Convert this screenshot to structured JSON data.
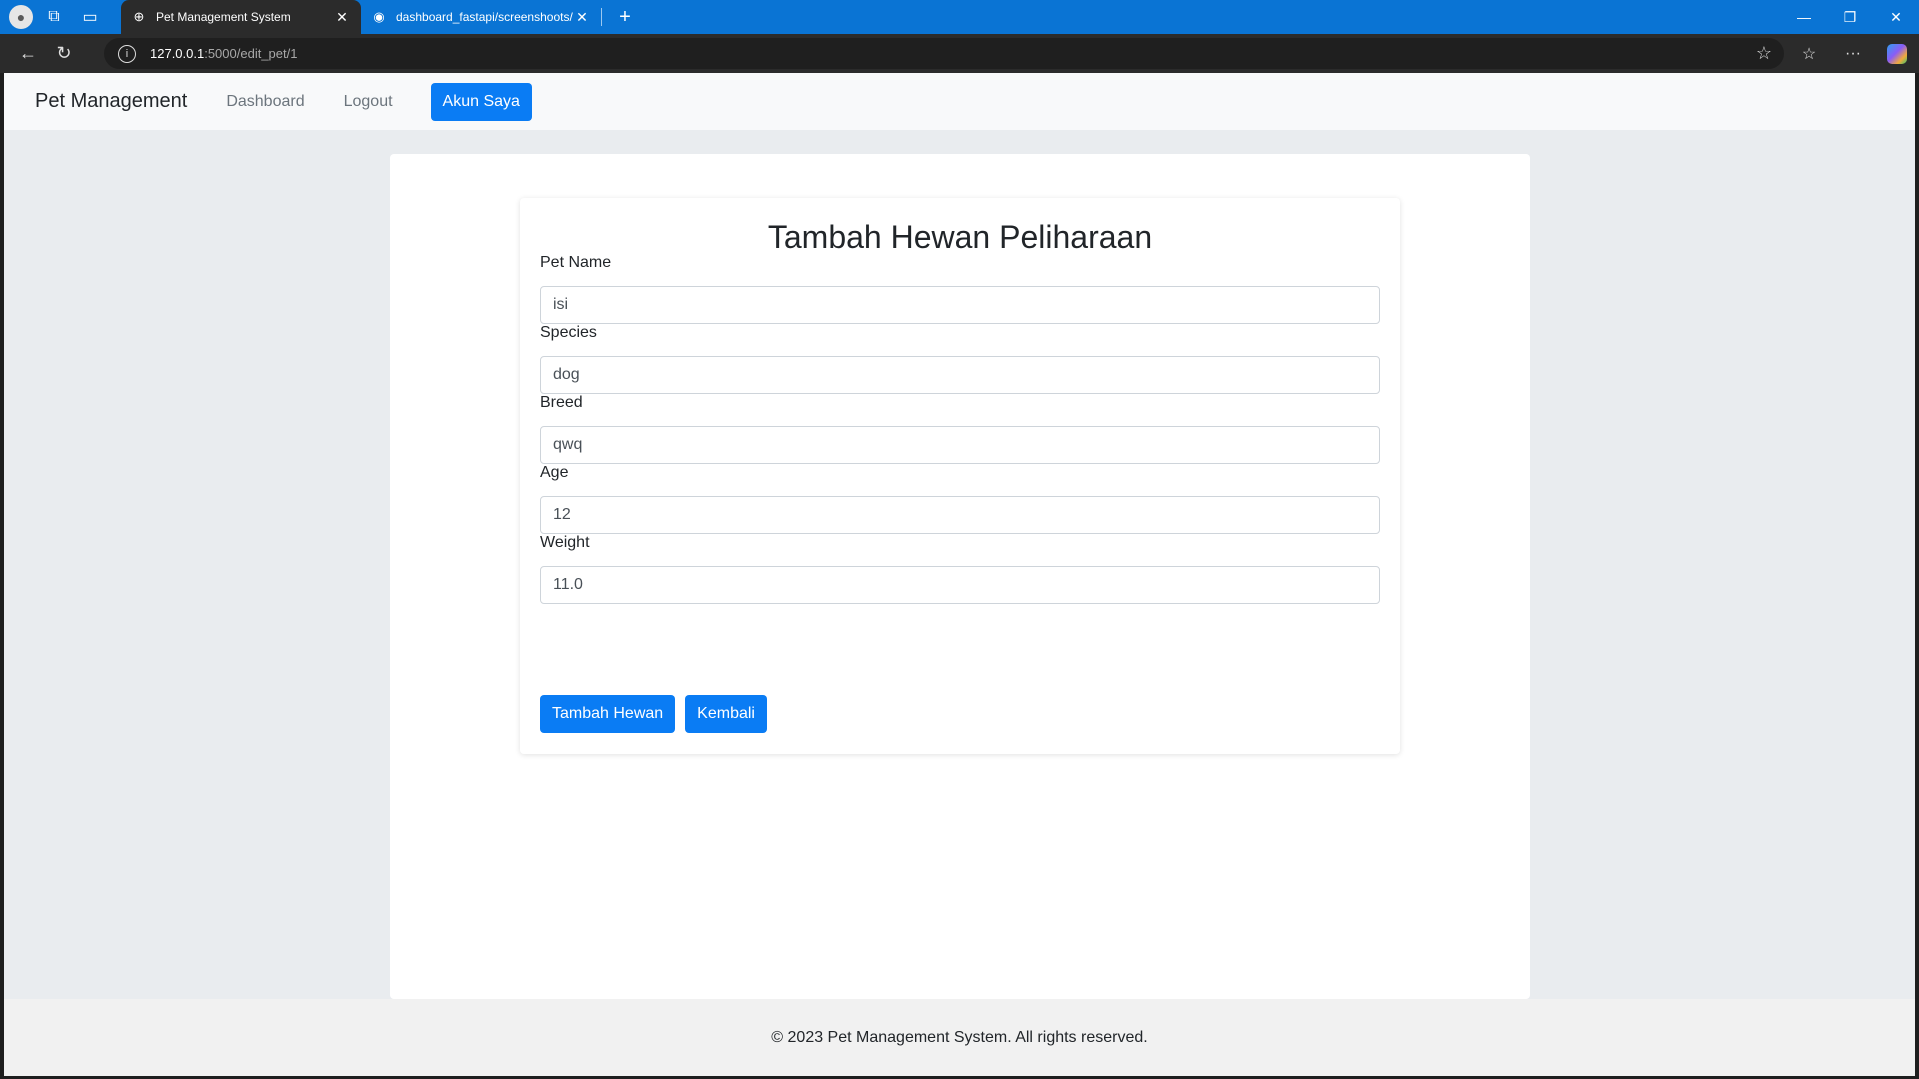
{
  "browser": {
    "tabs": [
      {
        "title": "Pet Management System",
        "active": true,
        "favicon": "globe-icon"
      },
      {
        "title": "dashboard_fastapi/screenshoots/",
        "active": false,
        "favicon": "github-icon"
      }
    ],
    "address": {
      "host": "127.0.0.1",
      "path": ":5000/edit_pet/1"
    }
  },
  "navbar": {
    "brand": "Pet Management",
    "links": [
      "Dashboard",
      "Logout"
    ],
    "account_button": "Akun Saya"
  },
  "form": {
    "title": "Tambah Hewan Peliharaan",
    "fields": [
      {
        "label": "Pet Name",
        "value": "isi"
      },
      {
        "label": "Species",
        "value": "dog"
      },
      {
        "label": "Breed",
        "value": "qwq"
      },
      {
        "label": "Age",
        "value": "12"
      },
      {
        "label": "Weight",
        "value": "11.0"
      }
    ],
    "submit_label": "Tambah Hewan",
    "back_label": "Kembali"
  },
  "footer": {
    "text": "© 2023 Pet Management System. All rights reserved."
  },
  "colors": {
    "primary": "#0a7cf4",
    "browser_frame": "#0a74d4",
    "page_background": "#e9ecef"
  }
}
